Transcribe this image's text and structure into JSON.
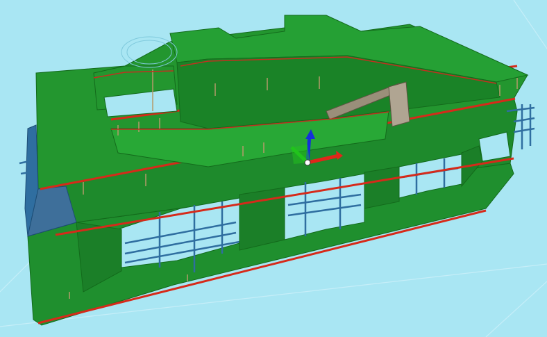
{
  "viewport": {
    "background": "#a9e6f3",
    "grid_color": "#c6eef8"
  },
  "model": {
    "hull_color": "#1f8f2e",
    "hull_dark": "#16701f",
    "hull_light": "#2fa63d",
    "trim_color": "#d62a1a",
    "frame_color": "#2f6ea0",
    "pipe_color": "#b59a6a",
    "equipment_color": "#9a8f7a",
    "panel_color": "#3e6f9a"
  },
  "gizmo": {
    "x_color": "#e0261a",
    "y_color": "#21c41c",
    "z_color": "#1530d8",
    "center_color": "#ffffff",
    "icon": "transform-gizmo-icon"
  }
}
